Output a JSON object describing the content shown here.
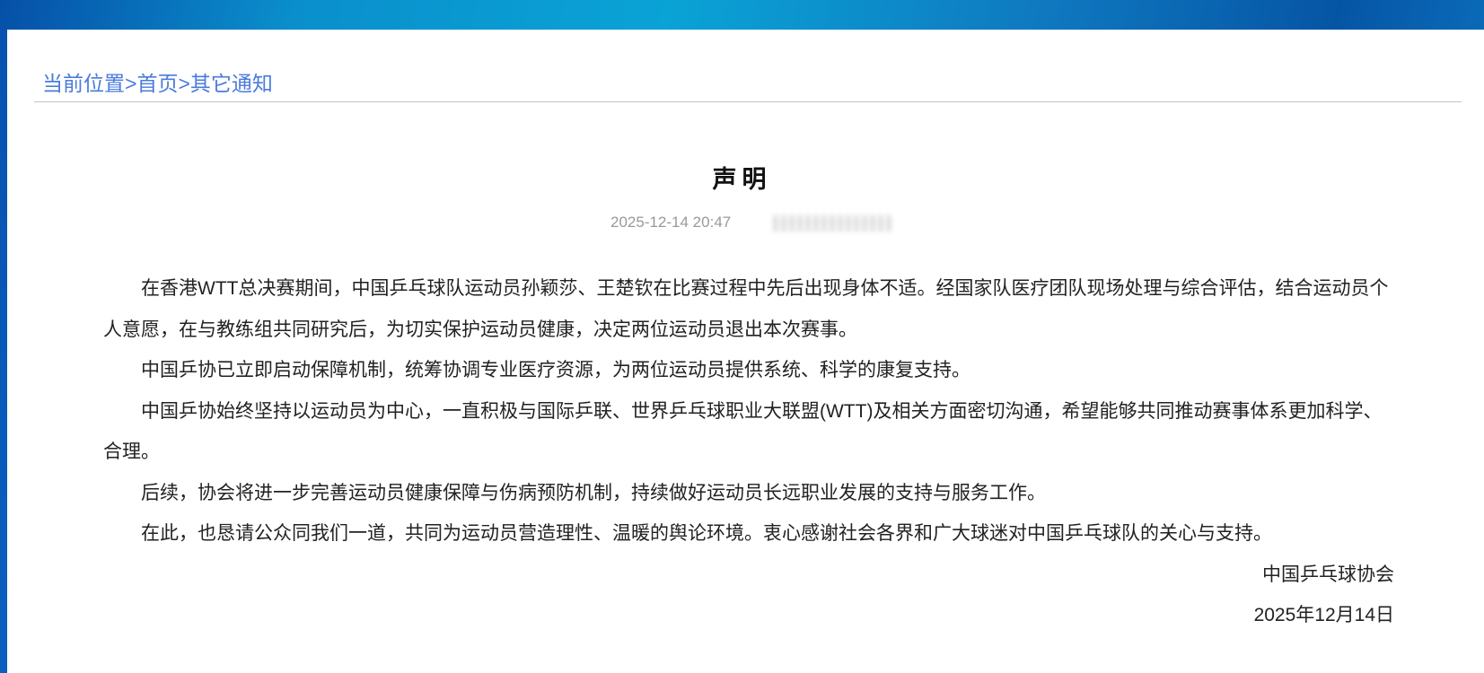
{
  "breadcrumb": {
    "prefix": "当前位置",
    "sep": ">",
    "items": [
      "首页",
      "其它通知"
    ]
  },
  "article": {
    "title": "声明",
    "datetime": "2025-12-14 20:47",
    "paragraphs": [
      "在香港WTT总决赛期间，中国乒乓球队运动员孙颖莎、王楚钦在比赛过程中先后出现身体不适。经国家队医疗团队现场处理与综合评估，结合运动员个人意愿，在与教练组共同研究后，为切实保护运动员健康，决定两位运动员退出本次赛事。",
      "中国乒协已立即启动保障机制，统筹协调专业医疗资源，为两位运动员提供系统、科学的康复支持。",
      "中国乒协始终坚持以运动员为中心，一直积极与国际乒联、世界乒乓球职业大联盟(WTT)及相关方面密切沟通，希望能够共同推动赛事体系更加科学、合理。",
      "后续，协会将进一步完善运动员健康保障与伤病预防机制，持续做好运动员长远职业发展的支持与服务工作。",
      "在此，也恳请公众同我们一道，共同为运动员营造理性、温暖的舆论环境。衷心感谢社会各界和广大球迷对中国乒乓球队的关心与支持。"
    ],
    "signature": "中国乒乓球协会",
    "sign_date": "2025年12月14日"
  }
}
